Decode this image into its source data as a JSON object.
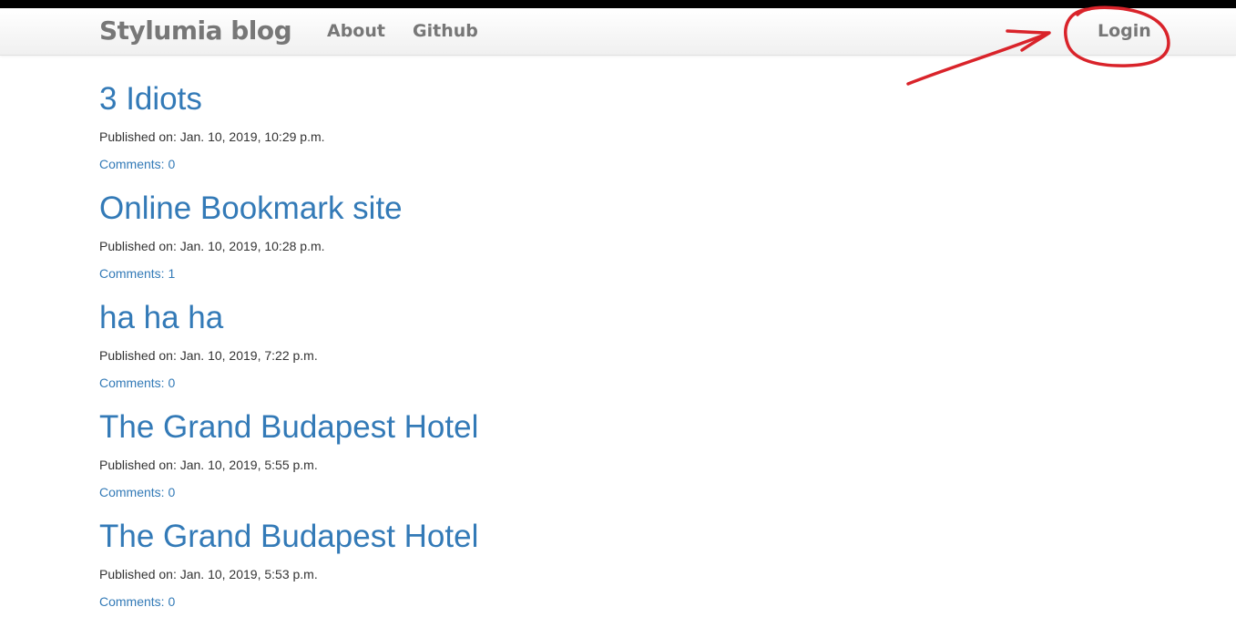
{
  "navbar": {
    "brand": "Stylumia blog",
    "links": {
      "about": "About",
      "github": "Github",
      "login": "Login"
    }
  },
  "posts": [
    {
      "title": "3 Idiots",
      "published": "Published on: Jan. 10, 2019, 10:29 p.m.",
      "comments": "Comments: 0"
    },
    {
      "title": "Online Bookmark site",
      "published": "Published on: Jan. 10, 2019, 10:28 p.m.",
      "comments": "Comments: 1"
    },
    {
      "title": "ha ha ha",
      "published": "Published on: Jan. 10, 2019, 7:22 p.m.",
      "comments": "Comments: 0"
    },
    {
      "title": "The Grand Budapest Hotel",
      "published": "Published on: Jan. 10, 2019, 5:55 p.m.",
      "comments": "Comments: 0"
    },
    {
      "title": "The Grand Budapest Hotel",
      "published": "Published on: Jan. 10, 2019, 5:53 p.m.",
      "comments": "Comments: 0"
    }
  ],
  "colors": {
    "link": "#337ab7",
    "nav_text": "#777777",
    "annotation": "#d9232a"
  }
}
